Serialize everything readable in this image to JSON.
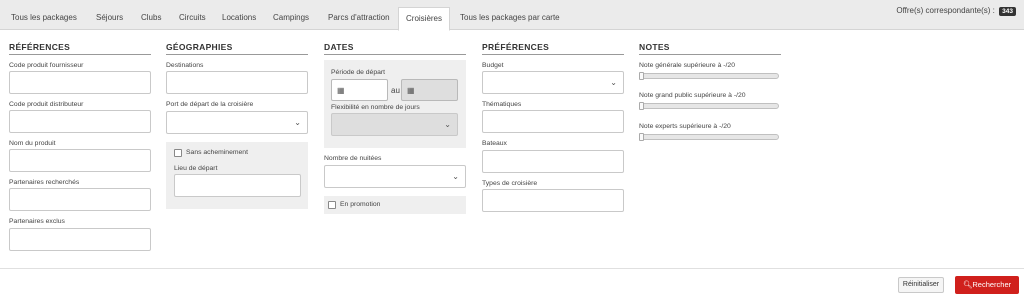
{
  "tabs": [
    {
      "label": "Tous les packages"
    },
    {
      "label": "Séjours"
    },
    {
      "label": "Clubs"
    },
    {
      "label": "Circuits"
    },
    {
      "label": "Locations"
    },
    {
      "label": "Campings"
    },
    {
      "label": "Parcs d'attraction"
    },
    {
      "label": "Croisières",
      "active": true
    },
    {
      "label": "Tous les packages par carte"
    }
  ],
  "results": {
    "label": "Offre(s) correspondante(s) :",
    "count": "343"
  },
  "references": {
    "title": "RÉFÉRENCES",
    "fields": [
      {
        "label": "Code produit fournisseur",
        "value": ""
      },
      {
        "label": "Code produit distributeur",
        "value": ""
      },
      {
        "label": "Nom du produit",
        "value": ""
      },
      {
        "label": "Partenaires recherchés",
        "value": ""
      },
      {
        "label": "Partenaires exclus",
        "value": ""
      }
    ]
  },
  "geographies": {
    "title": "GÉOGRAPHIES",
    "destinations_label": "Destinations",
    "port_label": "Port de départ de la croisière",
    "port_value": "",
    "sans_acheminement": {
      "label": "Sans acheminement",
      "checked": false
    },
    "lieu_label": "Lieu de départ"
  },
  "dates": {
    "title": "DATES",
    "periode_label": "Période de départ",
    "au_label": "au",
    "flexibilite_label": "Flexibilité en nombre de jours",
    "nuitees_label": "Nombre de nuitées",
    "promotion": {
      "label": "En promotion",
      "checked": false
    }
  },
  "preferences": {
    "title": "PRÉFÉRENCES",
    "budget_label": "Budget",
    "thematiques_label": "Thématiques",
    "bateaux_label": "Bateaux",
    "types_label": "Types de croisière"
  },
  "notes": {
    "title": "NOTES",
    "sliders": [
      {
        "label": "Note générale supérieure à -/20",
        "value": 0
      },
      {
        "label": "Note grand public supérieure à -/20",
        "value": 0
      },
      {
        "label": "Note experts supérieure à -/20",
        "value": 0
      }
    ]
  },
  "buttons": {
    "reset": "Réinitialiser",
    "search": "Rechercher"
  },
  "colors": {
    "accent": "#d0201c",
    "badge": "#333333",
    "tabbar": "#ebebeb"
  }
}
